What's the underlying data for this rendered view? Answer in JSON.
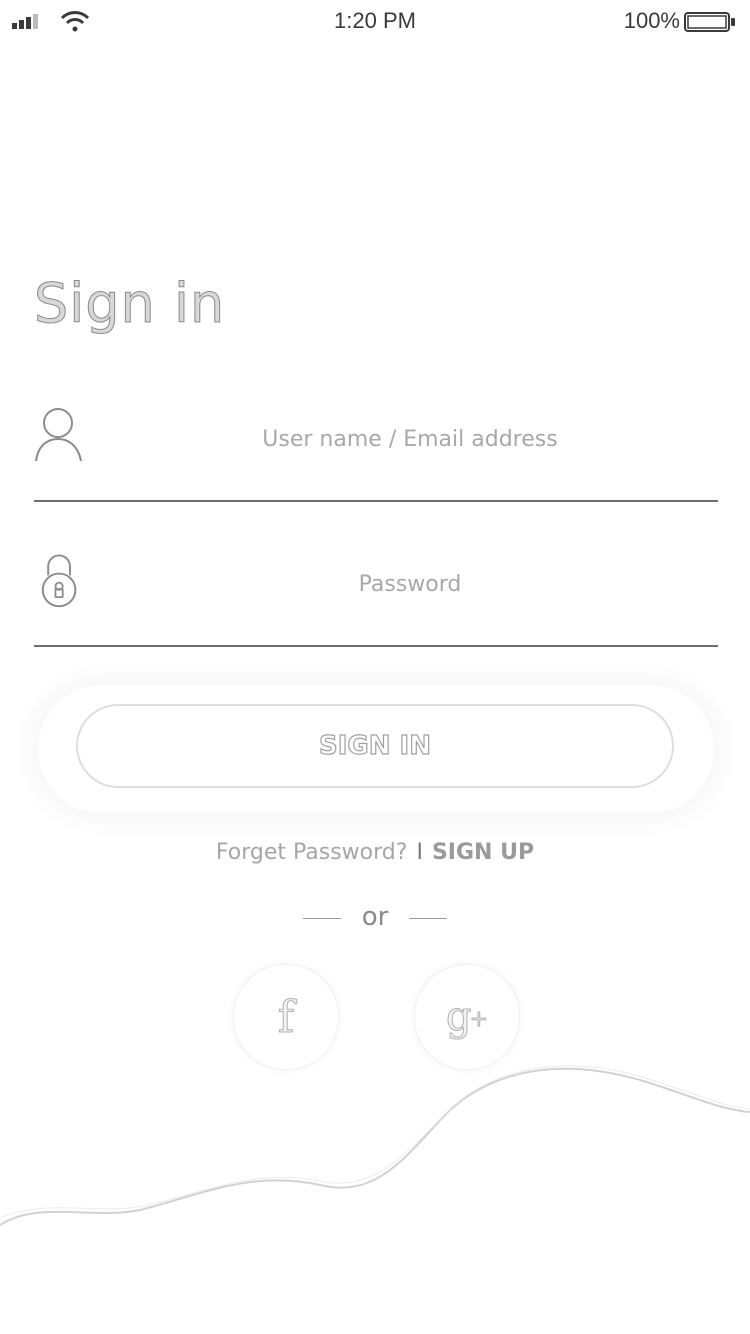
{
  "status_bar": {
    "time": "1:20 PM",
    "battery_percent": "100%",
    "signal_icon": "signal-bars-icon",
    "wifi_icon": "wifi-icon",
    "battery_icon": "battery-icon"
  },
  "title": "Sign in",
  "username_field": {
    "icon": "user-icon",
    "placeholder": "User name / Email address",
    "value": ""
  },
  "password_field": {
    "icon": "padlock-icon",
    "placeholder": "Password",
    "value": ""
  },
  "signin_button": {
    "label": "SIGN IN"
  },
  "links": {
    "forgot": "Forget Password?",
    "separator": "I",
    "signup": "SIGN UP"
  },
  "divider": {
    "label": "or"
  },
  "social": [
    {
      "name": "facebook",
      "icon": "facebook-icon",
      "glyph": "f"
    },
    {
      "name": "google-plus",
      "icon": "google-plus-icon",
      "glyph": "g",
      "glyph_suffix": "+"
    }
  ],
  "colors": {
    "background": "#ffffff",
    "text_gray": "#9a9a9a",
    "underline": "#6e6e6e",
    "button_border": "#dedede",
    "wave_stroke": "#cfcfcf"
  }
}
